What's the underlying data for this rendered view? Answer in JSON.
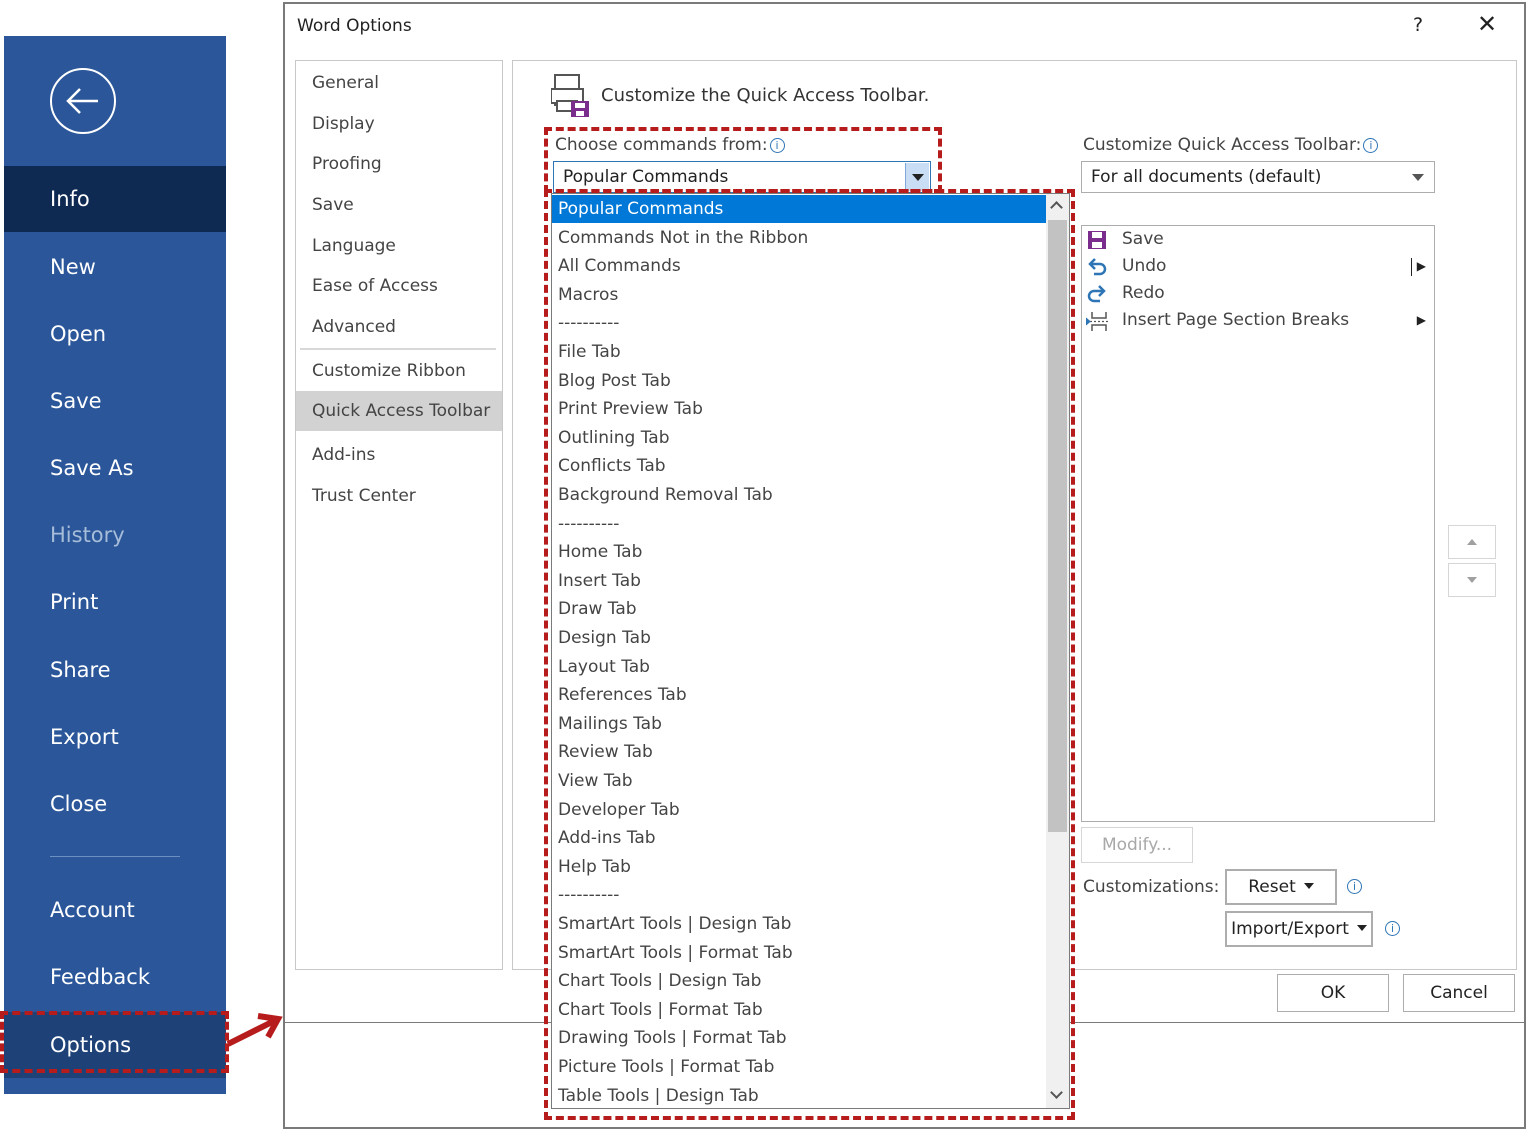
{
  "backstage": {
    "back_icon": "back-arrow-icon",
    "items": [
      "Info",
      "New",
      "Open",
      "Save",
      "Save As",
      "History",
      "Print",
      "Share",
      "Export",
      "Close"
    ],
    "bottom_items": [
      "Account",
      "Feedback",
      "Options"
    ],
    "active": "Info",
    "disabled": [
      "History"
    ],
    "accent_color": "#2b579a"
  },
  "dialog": {
    "title": "Word Options",
    "help": "?",
    "close": "✕",
    "nav": [
      "General",
      "Display",
      "Proofing",
      "Save",
      "Language",
      "Ease of Access",
      "Advanced",
      "Customize Ribbon",
      "Quick Access Toolbar",
      "Add-ins",
      "Trust Center"
    ],
    "nav_selected": "Quick Access Toolbar",
    "heading": "Customize the Quick Access Toolbar.",
    "choose_label": "Choose commands from:",
    "choose_value": "Popular Commands",
    "customize_label": "Customize Quick Access Toolbar:",
    "customize_value": "For all documents (default)",
    "qat_items": [
      {
        "label": "Save",
        "icon": "save-icon"
      },
      {
        "label": "Undo",
        "icon": "undo-icon"
      },
      {
        "label": "Redo",
        "icon": "redo-icon"
      },
      {
        "label": "Insert Page  Section Breaks",
        "icon": "page-break-icon"
      }
    ],
    "modify": "Modify...",
    "customizations_label": "Customizations:",
    "reset": "Reset",
    "import_export": "Import/Export",
    "ok": "OK",
    "cancel": "Cancel",
    "dropdown_options": [
      "Popular Commands",
      "Commands Not in the Ribbon",
      "All Commands",
      "Macros",
      "----------",
      "File Tab",
      "Blog Post Tab",
      "Print Preview Tab",
      "Outlining Tab",
      "Conflicts Tab",
      "Background Removal Tab",
      "----------",
      "Home Tab",
      "Insert Tab",
      "Draw Tab",
      "Design Tab",
      "Layout Tab",
      "References Tab",
      "Mailings Tab",
      "Review Tab",
      "View Tab",
      "Developer Tab",
      "Add-ins Tab",
      "Help Tab",
      "----------",
      "SmartArt Tools | Design Tab",
      "SmartArt Tools | Format Tab",
      "Chart Tools | Design Tab",
      "Chart Tools | Format Tab",
      "Drawing Tools | Format Tab",
      "Picture Tools | Format Tab",
      "Table Tools | Design Tab"
    ],
    "dropdown_selected": "Popular Commands",
    "selection_color": "#0078d7",
    "highlight_color": "#b71c1c"
  }
}
